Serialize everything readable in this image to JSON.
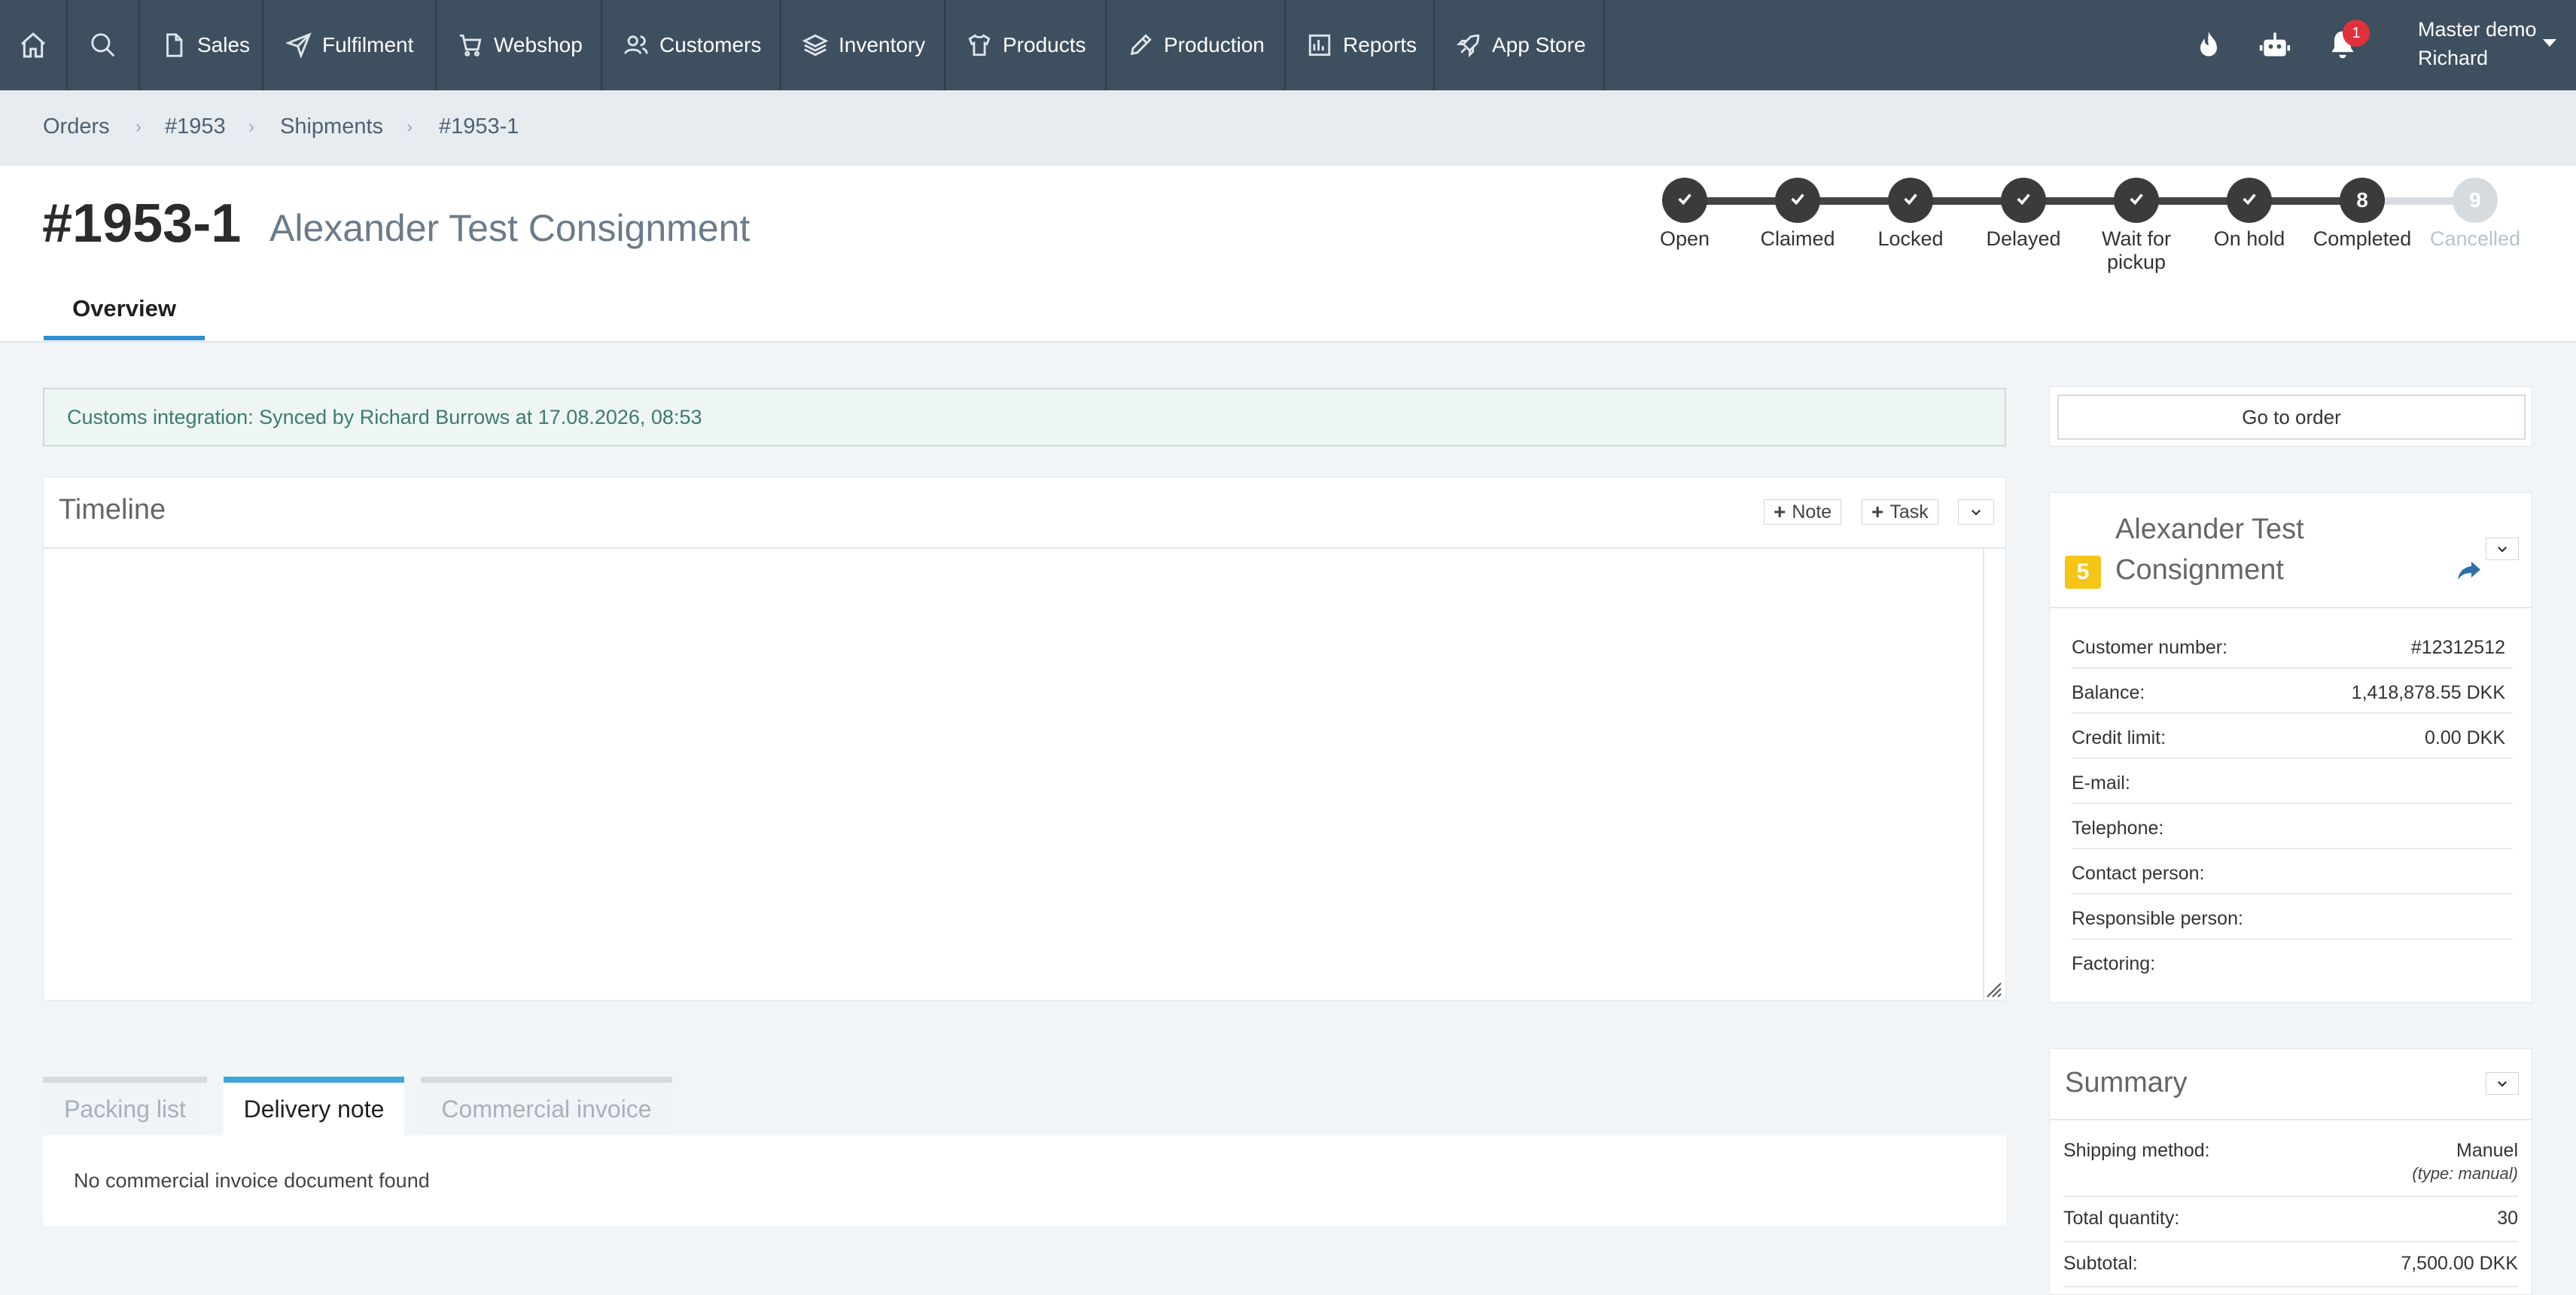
{
  "nav": {
    "items": [
      {
        "label": "Sales",
        "icon": "document-icon"
      },
      {
        "label": "Fulfilment",
        "icon": "send-icon"
      },
      {
        "label": "Webshop",
        "icon": "cart-icon"
      },
      {
        "label": "Customers",
        "icon": "users-icon"
      },
      {
        "label": "Inventory",
        "icon": "layers-icon"
      },
      {
        "label": "Products",
        "icon": "shirt-icon"
      },
      {
        "label": "Production",
        "icon": "pencil-icon"
      },
      {
        "label": "Reports",
        "icon": "chart-icon"
      },
      {
        "label": "App Store",
        "icon": "rocket-icon"
      }
    ],
    "notification_count": "1",
    "user_company": "Master demo",
    "user_name": "Richard"
  },
  "breadcrumb": [
    "Orders",
    "#1953",
    "Shipments",
    "#1953-1"
  ],
  "header": {
    "order_id": "#1953-1",
    "order_name": "Alexander Test Consignment",
    "tab_overview": "Overview"
  },
  "statuses": [
    {
      "label": "Open",
      "state": "done"
    },
    {
      "label": "Claimed",
      "state": "done"
    },
    {
      "label": "Locked",
      "state": "done"
    },
    {
      "label": "Delayed",
      "state": "done"
    },
    {
      "label": "Wait for pickup",
      "state": "done"
    },
    {
      "label": "On hold",
      "state": "done"
    },
    {
      "label": "Completed",
      "state": "current",
      "number": "8"
    },
    {
      "label": "Cancelled",
      "state": "off",
      "number": "9"
    }
  ],
  "notice": "Customs integration: Synced by Richard Burrows at 17.08.2026, 08:53",
  "timeline": {
    "title": "Timeline",
    "note_label": "Note",
    "task_label": "Task"
  },
  "doc_tabs": {
    "packing": "Packing list",
    "delivery": "Delivery note",
    "commercial": "Commercial invoice",
    "message": "No commercial invoice document found"
  },
  "right": {
    "goto_order": "Go to order",
    "customer_name": "Alexander Test Consignment",
    "customer_badge": "5",
    "fields": [
      {
        "k": "Customer number:",
        "v": "#12312512"
      },
      {
        "k": "Balance:",
        "v": "1,418,878.55 DKK"
      },
      {
        "k": "Credit limit:",
        "v": "0.00 DKK"
      },
      {
        "k": "E-mail:",
        "v": ""
      },
      {
        "k": "Telephone:",
        "v": ""
      },
      {
        "k": "Contact person:",
        "v": ""
      },
      {
        "k": "Responsible person:",
        "v": ""
      },
      {
        "k": "Factoring:",
        "v": ""
      }
    ]
  },
  "summary": {
    "title": "Summary",
    "shipping_k": "Shipping method:",
    "shipping_v": "Manuel",
    "shipping_sub": "(type: manual)",
    "qty_k": "Total quantity:",
    "qty_v": "30",
    "subtotal_k": "Subtotal:",
    "subtotal_v": "7,500.00 DKK"
  },
  "colors": {
    "topnav": "#3e4f5f",
    "accent": "#2f8fd0",
    "notice_bg": "#eef6f4",
    "badge_yellow": "#f5c518",
    "alert_red": "#e0323c"
  }
}
